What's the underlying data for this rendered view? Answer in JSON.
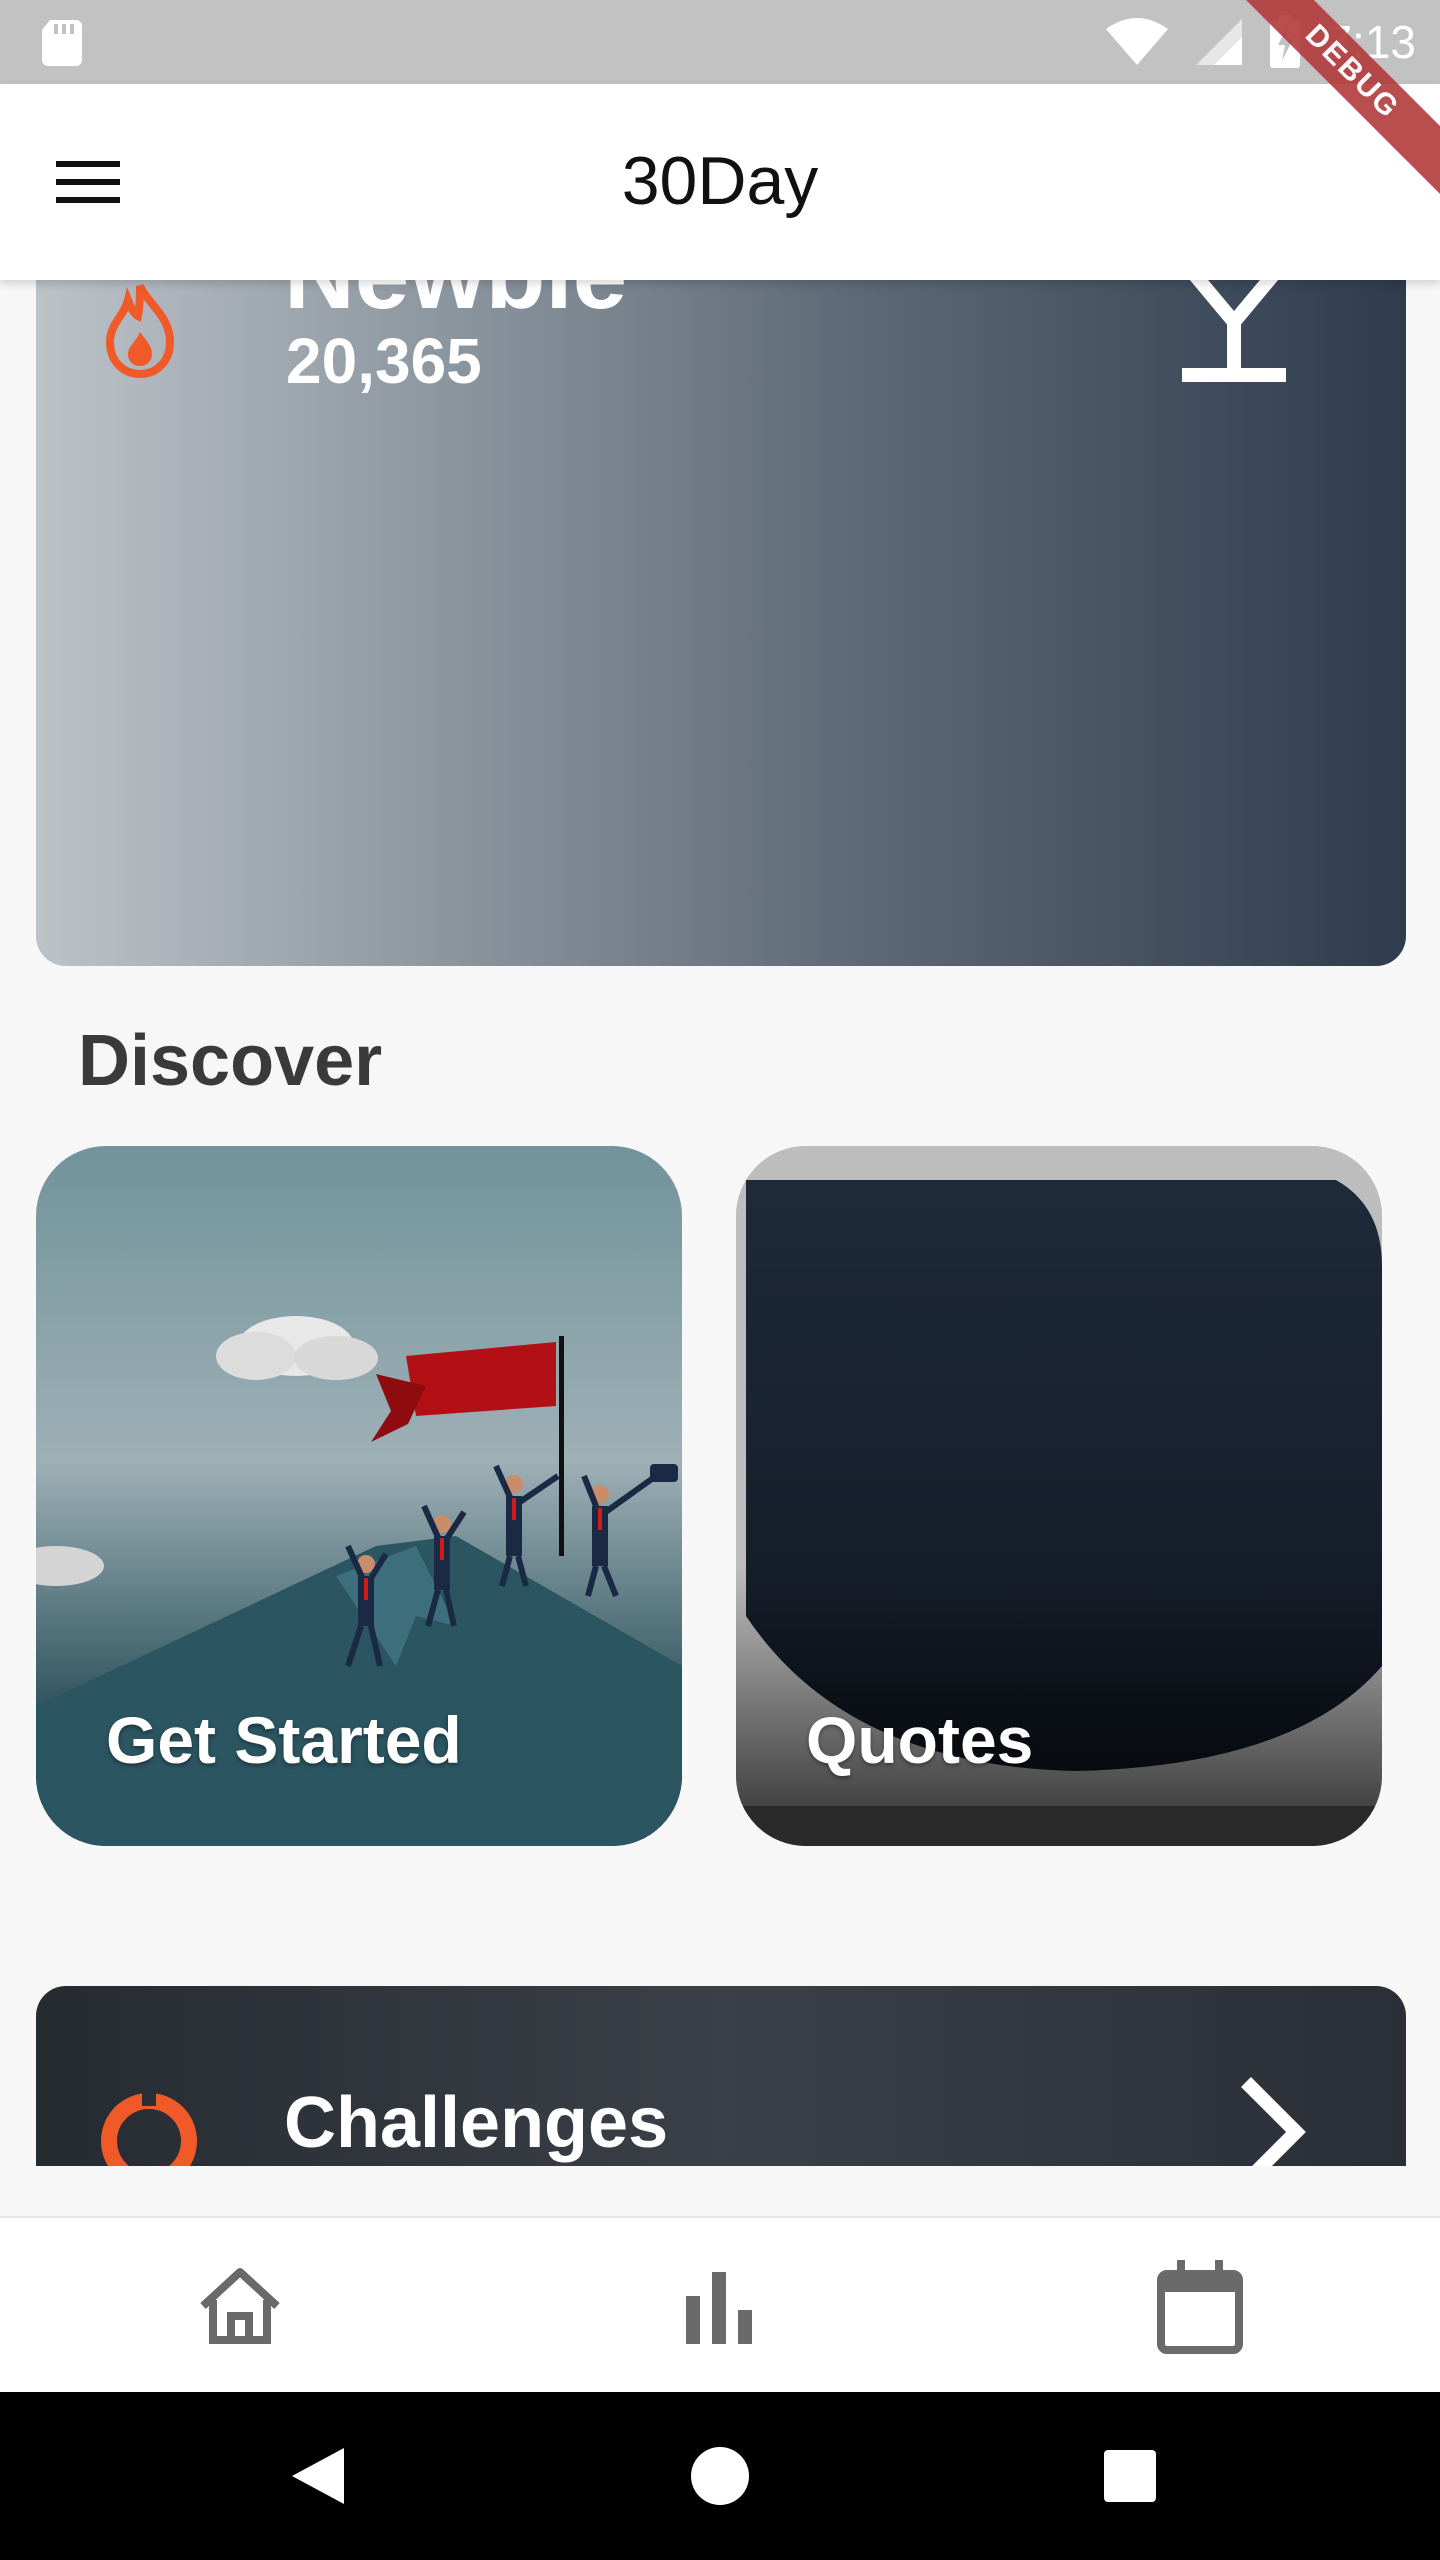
{
  "status_bar": {
    "time": "7:13",
    "icons": [
      "sd-card-icon",
      "wifi-icon",
      "signal-icon",
      "battery-charging-icon"
    ]
  },
  "debug_banner": "DEBUG",
  "app_bar": {
    "title": "30Day",
    "menu_icon": "hamburger-menu-icon"
  },
  "level_card": {
    "title": "Newbie",
    "points": "20,365",
    "left_icon": "flame-icon",
    "right_icon": "cocktail-glass-icon",
    "accent": "#f05a28"
  },
  "discover": {
    "title": "Discover",
    "cards": [
      {
        "label": "Get Started"
      },
      {
        "label": "Quotes"
      }
    ]
  },
  "challenges": {
    "title": "Challenges",
    "icon": "target-icon",
    "action_icon": "chevron-right-icon"
  },
  "bottom_nav": {
    "items": [
      "home-icon",
      "bar-chart-icon",
      "calendar-icon"
    ]
  },
  "system_nav": {
    "items": [
      "back-icon",
      "home-circle-icon",
      "recents-icon"
    ]
  }
}
